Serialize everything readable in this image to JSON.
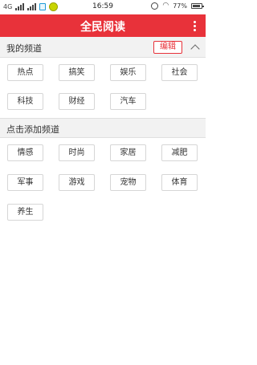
{
  "status_bar": {
    "network": "4G",
    "time": "16:59",
    "battery_percent": "77%"
  },
  "app": {
    "title": "全民阅读"
  },
  "my_channels": {
    "heading": "我的频道",
    "edit_label": "编辑",
    "items": [
      "热点",
      "搞笑",
      "娱乐",
      "社会",
      "科技",
      "财经",
      "汽车"
    ]
  },
  "add_channels": {
    "heading": "点击添加频道",
    "items": [
      "情感",
      "时尚",
      "家居",
      "减肥",
      "军事",
      "游戏",
      "宠物",
      "体育",
      "养生"
    ]
  },
  "colors": {
    "accent": "#e8323a",
    "section_bg": "#f2f2f2",
    "chip_border": "#d6d6d6"
  }
}
